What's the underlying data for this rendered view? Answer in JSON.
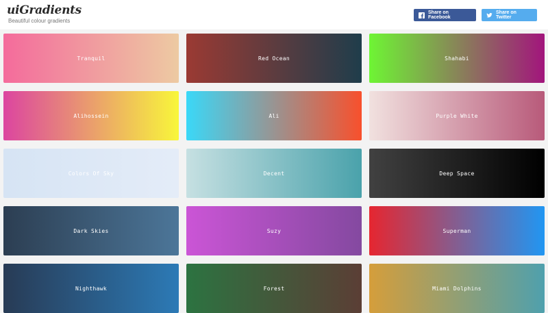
{
  "header": {
    "logo": "uiGradients",
    "tagline": "Beautiful colour gradients",
    "share_facebook": "Share on Facebook",
    "share_twitter": "Share on Twitter"
  },
  "gradients": [
    {
      "name": "Tranquil",
      "colors": [
        "#EE9CA7",
        "#FFDDE1"
      ],
      "stops": [
        "#f46b9c",
        "#edcaa2"
      ]
    },
    {
      "name": "Red Ocean",
      "stops": [
        "#9b3a33",
        "#1f3d4b"
      ]
    },
    {
      "name": "Shahabi",
      "stops": [
        "#6ef534",
        "#a2157c"
      ]
    },
    {
      "name": "Alihossein",
      "stops": [
        "#dc45a0",
        "#f8f63a"
      ]
    },
    {
      "name": "Ali",
      "stops": [
        "#3ad8f8",
        "#f8502c"
      ]
    },
    {
      "name": "Purple White",
      "stops": [
        "#f1e1df",
        "#b85a7a"
      ]
    },
    {
      "name": "Colors Of Sky",
      "stops": [
        "#d6e4f4",
        "#e4ecf8"
      ]
    },
    {
      "name": "Decent",
      "stops": [
        "#c6e0e2",
        "#4aa2ab"
      ]
    },
    {
      "name": "Deep Space",
      "stops": [
        "#414141",
        "#000000"
      ]
    },
    {
      "name": "Dark Skies",
      "stops": [
        "#2c3e52",
        "#4c7699"
      ]
    },
    {
      "name": "Suzy",
      "stops": [
        "#cb55d6",
        "#8449a0"
      ]
    },
    {
      "name": "Superman",
      "stops": [
        "#e62630",
        "#2196f2"
      ]
    },
    {
      "name": "Nighthawk",
      "stops": [
        "#283b55",
        "#2c7ab6"
      ]
    },
    {
      "name": "Forest",
      "stops": [
        "#2c7341",
        "#5b3e35"
      ]
    },
    {
      "name": "Miami Dolphins",
      "stops": [
        "#d59e3b",
        "#4fa0ad"
      ]
    }
  ]
}
